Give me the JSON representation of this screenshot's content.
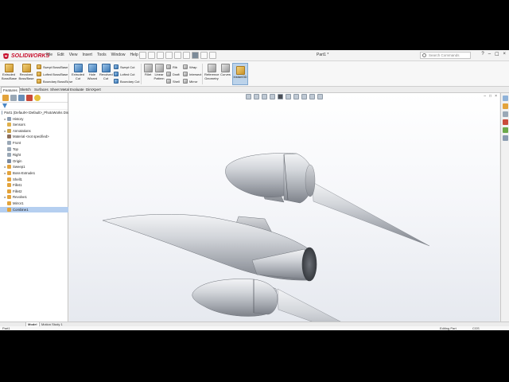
{
  "app": {
    "logo_text": "SOLIDWORKS",
    "document_title": "Part1 *",
    "search_placeholder": "Search Commands"
  },
  "menu": [
    "File",
    "Edit",
    "View",
    "Insert",
    "Tools",
    "Window",
    "Help"
  ],
  "window_controls": [
    "?",
    "–",
    "☐",
    "×"
  ],
  "ribbon": {
    "extruded_boss": "Extruded Boss/Base",
    "revolved_boss": "Revolved Boss/Base",
    "swept_boss": "Swept Boss/Base",
    "lofted_boss": "Lofted Boss/Base",
    "boundary_boss": "Boundary Boss/Base",
    "extruded_cut": "Extruded Cut",
    "hole_wizard": "Hole Wizard",
    "revolved_cut": "Revolved Cut",
    "swept_cut": "Swept Cut",
    "lofted_cut": "Lofted Cut",
    "boundary_cut": "Boundary Cut",
    "fillet": "Fillet",
    "linear_pattern": "Linear Pattern",
    "rib": "Rib",
    "draft": "Draft",
    "shell": "Shell",
    "wrap": "Wrap",
    "intersect": "Intersect",
    "mirror": "Mirror",
    "reference_geometry": "Reference Geometry",
    "curves": "Curves",
    "instant3d": "Instant3D"
  },
  "tabs": [
    "Features",
    "Sketch",
    "Surfaces",
    "Sheet Metal",
    "Evaluate",
    "DimXpert"
  ],
  "feature_tree": [
    {
      "label": "Part1  (Default<<Default>_PhotoWorks Dis",
      "indent": 0,
      "exp": "",
      "icon": "#8a9bb0"
    },
    {
      "label": "History",
      "indent": 1,
      "exp": "▸",
      "icon": "#8a9bb0"
    },
    {
      "label": "Sensors",
      "indent": 1,
      "exp": "",
      "icon": "#e0b04a"
    },
    {
      "label": "Annotations",
      "indent": 1,
      "exp": "▸",
      "icon": "#c9a24a"
    },
    {
      "label": "Material <not specified>",
      "indent": 1,
      "exp": "",
      "icon": "#8d6e5a"
    },
    {
      "label": "Front",
      "indent": 1,
      "exp": "",
      "icon": "#9aa8b6"
    },
    {
      "label": "Top",
      "indent": 1,
      "exp": "",
      "icon": "#9aa8b6"
    },
    {
      "label": "Right",
      "indent": 1,
      "exp": "",
      "icon": "#9aa8b6"
    },
    {
      "label": "Origin",
      "indent": 1,
      "exp": "",
      "icon": "#7a8aa0"
    },
    {
      "label": "Sweep1",
      "indent": 1,
      "exp": "▸",
      "icon": "#e3a33b"
    },
    {
      "label": "Boss-Extrude1",
      "indent": 1,
      "exp": "▸",
      "icon": "#e3a33b"
    },
    {
      "label": "Shell1",
      "indent": 1,
      "exp": "",
      "icon": "#e3a33b"
    },
    {
      "label": "Fillet1",
      "indent": 1,
      "exp": "",
      "icon": "#e3a33b"
    },
    {
      "label": "Fillet2",
      "indent": 1,
      "exp": "",
      "icon": "#e3a33b"
    },
    {
      "label": "Revolve1",
      "indent": 1,
      "exp": "▸",
      "icon": "#e3a33b"
    },
    {
      "label": "Mirror1",
      "indent": 1,
      "exp": "",
      "icon": "#e3a33b"
    },
    {
      "label": "Combine1",
      "indent": 1,
      "exp": "",
      "icon": "#e3a33b",
      "selected": true
    }
  ],
  "bottom_tabs": [
    "Model",
    "Motion Study 1"
  ],
  "status": {
    "left": "Part1",
    "mode": "Editing Part",
    "units": "CGS"
  },
  "colors": {
    "accent": "#c8102e",
    "selection": "#b5cff0",
    "body_metal": "#b9bcc2"
  }
}
